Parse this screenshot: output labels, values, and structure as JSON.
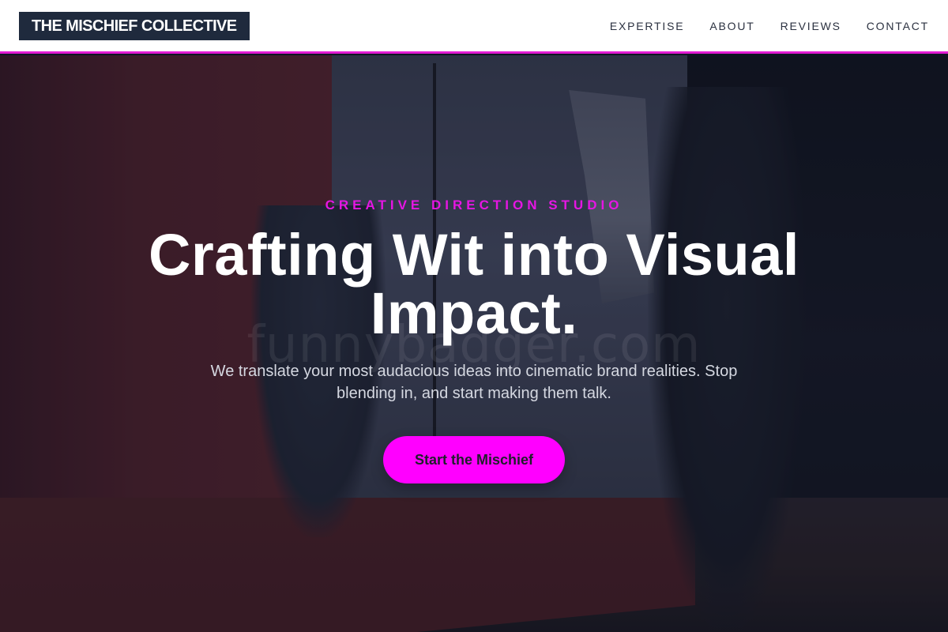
{
  "header": {
    "logo": "THE MISCHIEF COLLECTIVE",
    "nav": [
      {
        "label": "EXPERTISE"
      },
      {
        "label": "ABOUT"
      },
      {
        "label": "REVIEWS"
      },
      {
        "label": "CONTACT"
      }
    ]
  },
  "hero": {
    "eyebrow": "CREATIVE DIRECTION STUDIO",
    "headline": "Crafting Wit into Visual Impact.",
    "subtext": "We translate your most audacious ideas into cinematic brand realities. Stop blending in, and start making them talk.",
    "cta": "Start the Mischief",
    "watermark": "funnybadger.com"
  },
  "colors": {
    "accent": "#ff00ff",
    "logo_bg": "#1f2a3d",
    "header_bg": "#ffffff"
  }
}
